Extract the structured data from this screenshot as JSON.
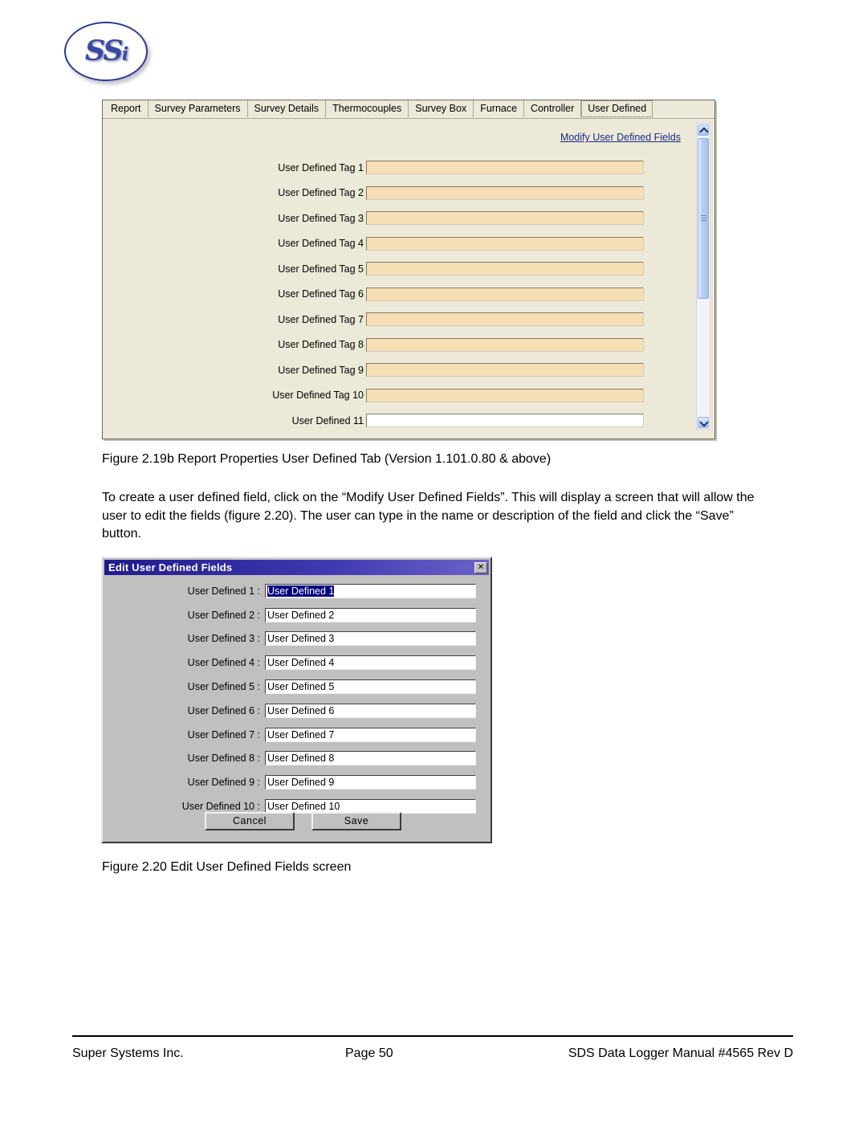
{
  "logo": {
    "text": "SS",
    "suffix": "i",
    "name": "ssi-logo"
  },
  "figure1": {
    "tabs": [
      {
        "label": "Report",
        "active": false
      },
      {
        "label": "Survey Parameters",
        "active": false
      },
      {
        "label": "Survey Details",
        "active": false
      },
      {
        "label": "Thermocouples",
        "active": false
      },
      {
        "label": "Survey Box",
        "active": false
      },
      {
        "label": "Furnace",
        "active": false
      },
      {
        "label": "Controller",
        "active": false
      },
      {
        "label": "User Defined",
        "active": true
      }
    ],
    "link_label": "Modify User Defined Fields",
    "link_color": "#1a2c87",
    "field_fill_color": "#f7dfb5",
    "rows": [
      {
        "label": "User Defined Tag 1",
        "value": "",
        "white": false
      },
      {
        "label": "User Defined Tag 2",
        "value": "",
        "white": false
      },
      {
        "label": "User Defined Tag 3",
        "value": "",
        "white": false
      },
      {
        "label": "User Defined Tag 4",
        "value": "",
        "white": false
      },
      {
        "label": "User Defined Tag 5",
        "value": "",
        "white": false
      },
      {
        "label": "User Defined Tag 6",
        "value": "",
        "white": false
      },
      {
        "label": "User Defined Tag 7",
        "value": "",
        "white": false
      },
      {
        "label": "User Defined Tag 8",
        "value": "",
        "white": false
      },
      {
        "label": "User Defined Tag 9",
        "value": "",
        "white": false
      },
      {
        "label": "User Defined Tag 10",
        "value": "",
        "white": false
      },
      {
        "label": "User Defined 11",
        "value": "",
        "white": true
      }
    ],
    "scrollbar": {
      "up_icon": "chevron-up-icon",
      "down_icon": "chevron-down-icon"
    }
  },
  "caption1": "Figure 2.19b Report Properties User Defined Tab (Version 1.101.0.80 & above)",
  "paragraph1": "To create a user defined field, click on the “Modify User Defined Fields”.  This will display a screen that will allow the user to edit the fields (figure 2.20).  The user can type in the name or description of the field and click the “Save” button.",
  "figure2": {
    "title": "Edit User Defined Fields",
    "title_bar_color": "#201a8c",
    "close_label": "✕",
    "selection_color": "#000080",
    "rows": [
      {
        "label": "User Defined 1 :",
        "value": "User Defined 1",
        "selected": true
      },
      {
        "label": "User Defined 2 :",
        "value": "User Defined 2",
        "selected": false
      },
      {
        "label": "User Defined 3 :",
        "value": "User Defined 3",
        "selected": false
      },
      {
        "label": "User Defined 4 :",
        "value": "User Defined 4",
        "selected": false
      },
      {
        "label": "User Defined 5 :",
        "value": "User Defined 5",
        "selected": false
      },
      {
        "label": "User Defined 6 :",
        "value": "User Defined 6",
        "selected": false
      },
      {
        "label": "User Defined 7 :",
        "value": "User Defined 7",
        "selected": false
      },
      {
        "label": "User Defined 8 :",
        "value": "User Defined 8",
        "selected": false
      },
      {
        "label": "User Defined 9 :",
        "value": "User Defined 9",
        "selected": false
      },
      {
        "label": "User Defined 10 :",
        "value": "User Defined 10",
        "selected": false
      }
    ],
    "cancel_label": "Cancel",
    "save_label": "Save"
  },
  "caption2": "Figure 2.20 Edit User Defined Fields screen",
  "footer": {
    "company": "Super Systems Inc.",
    "page": "Page 50",
    "manual": "SDS Data Logger Manual #4565 Rev D"
  }
}
